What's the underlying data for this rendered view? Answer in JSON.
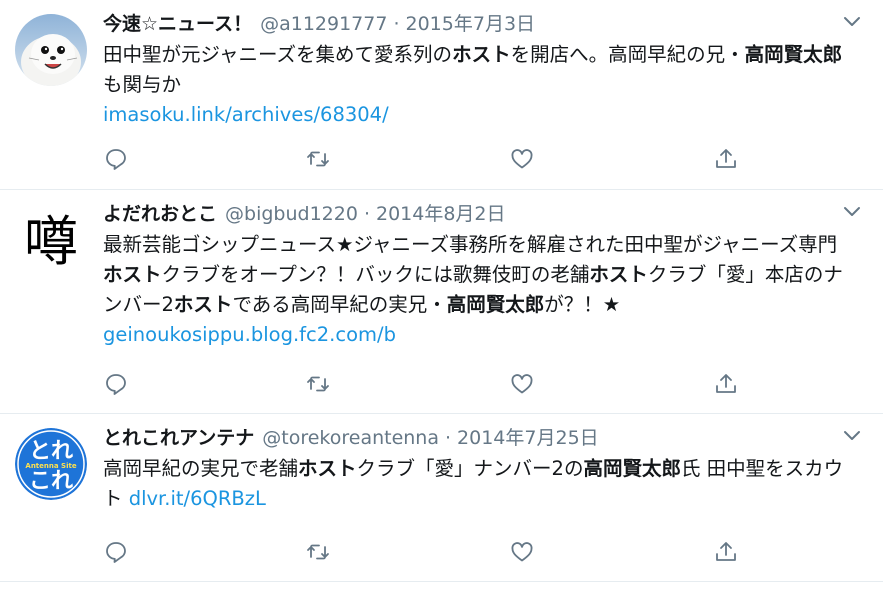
{
  "tweets": [
    {
      "name": "今速☆ニュース！",
      "handle": "@a11291777",
      "separator": "·",
      "date": "2015年7月3日",
      "avatar_icon": "seal-avatar",
      "text_parts": [
        "田中聖が元ジャニーズを集めて愛系列の",
        "ホスト",
        "を開店へ。高岡早紀の兄・",
        "高岡賢太郎",
        "も関与か"
      ],
      "link": "imasoku.link/archives/68304/"
    },
    {
      "name": "よだれおとこ",
      "handle": "@bigbud1220",
      "separator": "·",
      "date": "2014年8月2日",
      "avatar_icon": "kanji-avatar",
      "avatar_char": "噂",
      "text_parts": [
        "最新芸能ゴシップニュース★ジャニーズ事務所を解雇された田中聖がジャニーズ専門",
        "ホスト",
        "クラブをオープン？！バックには歌舞伎町の老舗",
        "ホスト",
        "クラブ「愛」本店のナンバー2",
        "ホスト",
        "である高岡早紀の実兄・",
        "高岡賢太郎",
        "が？！★ "
      ],
      "link": "geinoukosippu.blog.fc2.com/b"
    },
    {
      "name": "とれこれアンテナ",
      "handle": "@torekoreantenna",
      "separator": "·",
      "date": "2014年7月25日",
      "avatar_icon": "antenna-site-avatar",
      "avatar_text_top": "とれ",
      "avatar_text_mid": "Antenna Site",
      "avatar_text_bottom": "これ",
      "text_parts": [
        "高岡早紀の実兄で老舗",
        "ホスト",
        "クラブ「愛」ナンバー2の",
        "高岡賢太郎",
        "氏 田中聖をスカウト "
      ],
      "link": "dlvr.it/6QRBzL"
    }
  ],
  "icons": {
    "reply": "reply-icon",
    "retweet": "retweet-icon",
    "like": "heart-icon",
    "share": "share-icon",
    "menu": "chevron-down-icon"
  },
  "colors": {
    "text": "#14171a",
    "secondary": "#657786",
    "link": "#1b95e0",
    "divider": "#e6ecf0",
    "antenna_blue": "#1e74d8"
  }
}
